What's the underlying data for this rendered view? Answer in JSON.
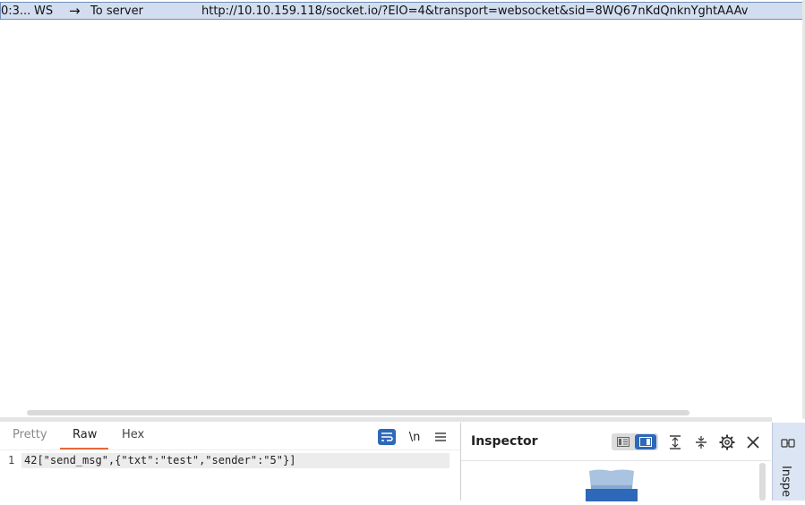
{
  "ws_row": {
    "time": "0:3...",
    "type": "WS",
    "direction": "To server",
    "url": "http://10.10.159.118/socket.io/?EIO=4&transport=websocket&sid=8WQ67nKdQnknYghtAAAv"
  },
  "editor": {
    "tabs": [
      "Pretty",
      "Raw",
      "Hex"
    ],
    "active_tab": "Raw",
    "newline_label": "\\n",
    "line_number": "1",
    "message": "42[\"send_msg\",{\"txt\":\"test\",\"sender\":\"5\"}]"
  },
  "inspector": {
    "title": "Inspector"
  },
  "side_tab": {
    "label": "Inspe"
  },
  "colors": {
    "accent": "#2e68b8",
    "tab_underline": "#e8693a",
    "row_highlight": "#d2def0"
  }
}
